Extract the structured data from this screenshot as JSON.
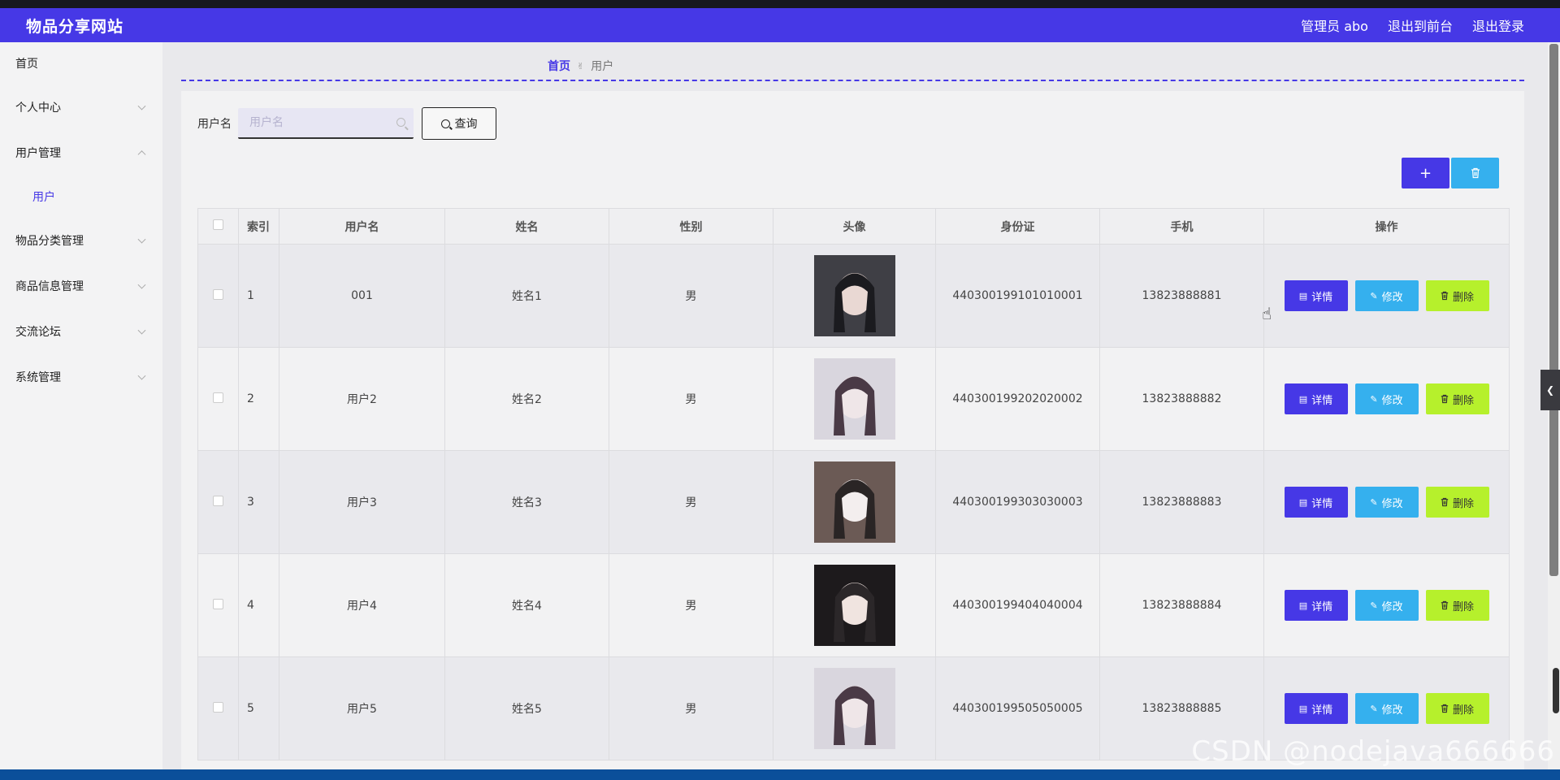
{
  "app": {
    "title": "物品分享网站"
  },
  "topbar": {
    "admin_label": "管理员 abo",
    "to_front": "退出到前台",
    "logout": "退出登录"
  },
  "sidebar": {
    "items": [
      {
        "label": "首页"
      },
      {
        "label": "个人中心"
      },
      {
        "label": "用户管理"
      },
      {
        "label": "用户"
      },
      {
        "label": "物品分类管理"
      },
      {
        "label": "商品信息管理"
      },
      {
        "label": "交流论坛"
      },
      {
        "label": "系统管理"
      }
    ]
  },
  "breadcrumb": {
    "home": "首页",
    "sep": "✌",
    "current": "用户"
  },
  "search": {
    "label": "用户名",
    "placeholder": "用户名",
    "value": "",
    "button": "查询"
  },
  "actions": {
    "add": "+",
    "delete": "🗑"
  },
  "table": {
    "columns": [
      "索引",
      "用户名",
      "姓名",
      "性别",
      "头像",
      "身份证",
      "手机",
      "操作"
    ],
    "rows": [
      {
        "index": "1",
        "username": "001",
        "name": "姓名1",
        "gender": "男",
        "id_card": "440300199101010001",
        "phone": "13823888881"
      },
      {
        "index": "2",
        "username": "用户2",
        "name": "姓名2",
        "gender": "男",
        "id_card": "440300199202020002",
        "phone": "13823888882"
      },
      {
        "index": "3",
        "username": "用户3",
        "name": "姓名3",
        "gender": "男",
        "id_card": "440300199303030003",
        "phone": "13823888883"
      },
      {
        "index": "4",
        "username": "用户4",
        "name": "姓名4",
        "gender": "男",
        "id_card": "440300199404040004",
        "phone": "13823888884"
      },
      {
        "index": "5",
        "username": "用户5",
        "name": "姓名5",
        "gender": "男",
        "id_card": "440300199505050005",
        "phone": "13823888885"
      }
    ],
    "op_detail": "详情",
    "op_edit": "修改",
    "op_delete": "删除"
  },
  "watermark": "CSDN @nodejava666666",
  "colors": {
    "primary": "#4638e6",
    "info": "#35b0ee",
    "danger_lime": "#b6f02c"
  }
}
